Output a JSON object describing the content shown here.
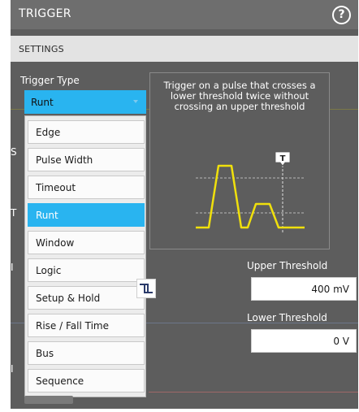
{
  "window": {
    "title": "TRIGGER",
    "help_icon": "?"
  },
  "section": {
    "label": "SETTINGS"
  },
  "trigger_type": {
    "label": "Trigger Type",
    "selected": "Runt",
    "options": [
      "Edge",
      "Pulse Width",
      "Timeout",
      "Runt",
      "Window",
      "Logic",
      "Setup & Hold",
      "Rise / Fall Time",
      "Bus",
      "Sequence"
    ],
    "selected_index": 3
  },
  "diagram": {
    "description": "Trigger on a pulse that crosses a lower threshold twice without crossing an upper threshold",
    "marker": "T"
  },
  "upper_threshold": {
    "label": "Upper Threshold",
    "value": "400 mV"
  },
  "lower_threshold": {
    "label": "Lower Threshold",
    "value": "0 V"
  },
  "colors": {
    "accent": "#29b4f0",
    "trace": "#f0e00c",
    "panel": "#5d5d5d"
  }
}
